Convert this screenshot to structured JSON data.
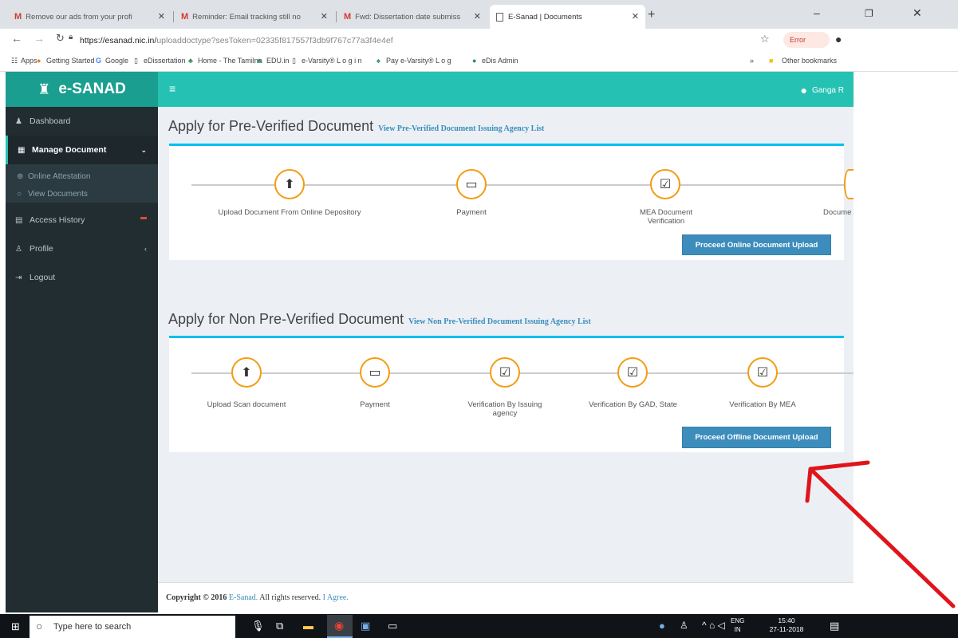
{
  "browser": {
    "tabs": [
      {
        "label": "Remove our ads from your profi",
        "icon": "gmail-icon"
      },
      {
        "label": "Reminder: Email tracking still no",
        "icon": "gmail-icon"
      },
      {
        "label": "Fwd: Dissertation date submiss",
        "icon": "gmail-icon"
      },
      {
        "label": "E-Sanad | Documents",
        "icon": "page-icon"
      }
    ],
    "url_host": "https://esanad.nic.in/",
    "url_path": "uploaddoctype?sesToken=02335f817557f3db9f767c77a3f4e4ef",
    "profile_label": "Error",
    "bookmarks": [
      "Apps",
      "Getting Started",
      "Google",
      "eDissertation",
      "Home - The Tamilna",
      "EDU.in",
      "e-Varsity® L o g i n",
      "Pay e-Varsity® L o g",
      "eDis Admin",
      "Other bookmarks"
    ]
  },
  "app": {
    "brand": "e-SANAD",
    "user": "Ganga R",
    "nav": [
      {
        "label": "Dashboard"
      },
      {
        "label": "Manage Document"
      },
      {
        "label": "Online Attestation"
      },
      {
        "label": "View Documents"
      },
      {
        "label": "Access History"
      },
      {
        "label": "Profile"
      },
      {
        "label": "Logout"
      }
    ],
    "pre": {
      "title": "Apply for Pre-Verified Document",
      "link": "View Pre-Verified Document Issuing Agency List",
      "steps": [
        "Upload Document From Online Depository",
        "Payment",
        "MEA Document Verification",
        "Docume"
      ],
      "button": "Proceed Online Document Upload"
    },
    "nonpre": {
      "title": "Apply for Non Pre-Verified Document",
      "link": "View Non Pre-Verified Document Issuing Agency List",
      "steps": [
        "Upload Scan document",
        "Payment",
        "Verification By Issuing agency",
        "Verification By GAD, State",
        "Verification By MEA"
      ],
      "button": "Proceed Offline Document Upload"
    },
    "footer": {
      "copyright": "Copyright © 2016",
      "brand": "E-Sanad.",
      "rights": "All rights reserved.",
      "agree": "I Agree."
    }
  },
  "taskbar": {
    "search_placeholder": "Type here to search",
    "lang": "ENG",
    "region": "IN",
    "time": "15:40",
    "date": "27-11-2018"
  },
  "colors": {
    "teal": "#25c2b3",
    "sidebar": "#222d32",
    "accent_border": "#00c0ef",
    "button": "#3c8dbc",
    "step_ring": "#f39c12",
    "arrow": "#e0141b"
  }
}
